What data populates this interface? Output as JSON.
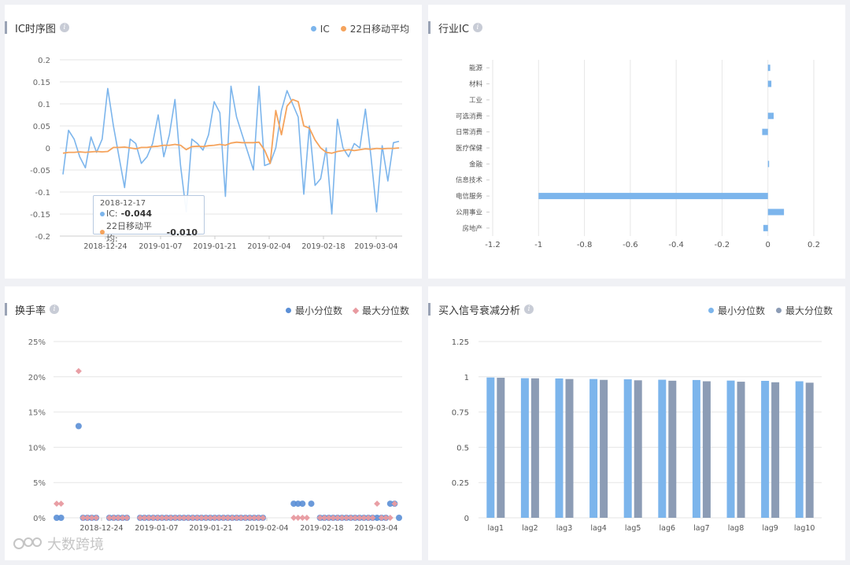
{
  "colors": {
    "ic": "#7cb5ec",
    "ma": "#f5a35c",
    "min": "#5b8fd6",
    "max": "#e89aa0",
    "bar_min": "#7cb5ec",
    "bar_max": "#8c9cb5",
    "grid": "#e6e6e6"
  },
  "panels": {
    "ic": {
      "title": "IC时序图",
      "info": "i",
      "legend": [
        "IC",
        "22日移动平均"
      ]
    },
    "industry": {
      "title": "行业IC",
      "info": "i"
    },
    "turnover": {
      "title": "换手率",
      "info": "i",
      "legend": [
        "最小分位数",
        "最大分位数"
      ]
    },
    "decay": {
      "title": "买入信号衰减分析",
      "info": "i",
      "legend": [
        "最小分位数",
        "最大分位数"
      ]
    }
  },
  "tooltip": {
    "date": "2018-12-17",
    "ic_label": "IC:",
    "ic_value": "-0.044",
    "ma_label": "22日移动平均:",
    "ma_value": "-0.010"
  },
  "watermark": "大数跨境",
  "chart_data": [
    {
      "type": "line",
      "ylim": [
        -0.2,
        0.2
      ],
      "yticks": [
        "0.2",
        "0.15",
        "0.1",
        "0.05",
        "0",
        "-0.05",
        "-0.1",
        "-0.15",
        "-0.2"
      ],
      "xticks": [
        "2018-12-24",
        "2019-01-07",
        "2019-01-21",
        "2019-02-04",
        "2019-02-18",
        "2019-03-04"
      ],
      "series": [
        {
          "name": "IC",
          "values": [
            -0.06,
            0.04,
            0.02,
            -0.02,
            -0.045,
            0.025,
            -0.01,
            0.02,
            0.135,
            0.05,
            -0.02,
            -0.09,
            0.02,
            0.01,
            -0.035,
            -0.02,
            0.01,
            0.075,
            -0.02,
            0.03,
            0.11,
            -0.04,
            -0.145,
            0.02,
            0.01,
            -0.005,
            0.03,
            0.105,
            0.08,
            -0.11,
            0.14,
            0.07,
            0.03,
            -0.01,
            -0.05,
            0.14,
            -0.04,
            -0.035,
            0.0,
            0.085,
            0.13,
            0.1,
            0.07,
            -0.105,
            0.05,
            -0.085,
            -0.07,
            0.0,
            -0.15,
            0.065,
            0.0,
            -0.02,
            0.01,
            0.0,
            0.088,
            -0.02,
            -0.145,
            0.005,
            -0.075,
            0.012,
            0.015
          ]
        },
        {
          "name": "22日移动平均",
          "values": [
            -0.012,
            -0.01,
            -0.01,
            -0.009,
            -0.01,
            -0.009,
            -0.008,
            -0.009,
            -0.008,
            0.001,
            0.001,
            0.002,
            0.0,
            -0.002,
            0.001,
            0.001,
            0.003,
            0.004,
            0.006,
            0.006,
            0.008,
            0.006,
            -0.004,
            0.003,
            0.004,
            0.003,
            0.005,
            0.006,
            0.008,
            0.006,
            0.011,
            0.013,
            0.012,
            0.012,
            0.012,
            0.013,
            -0.005,
            -0.035,
            0.085,
            0.03,
            0.095,
            0.11,
            0.105,
            0.05,
            0.045,
            0.018,
            0.0,
            -0.01,
            -0.012,
            -0.008,
            -0.006,
            -0.004,
            -0.006,
            -0.004,
            -0.002,
            -0.003,
            -0.001,
            -0.002,
            -0.001,
            -0.001,
            0.0
          ]
        }
      ]
    },
    {
      "type": "bar",
      "orientation": "horizontal",
      "categories": [
        "能源",
        "材料",
        "工业",
        "可选消费",
        "日常消费",
        "医疗保健",
        "金融",
        "信息技术",
        "电信服务",
        "公用事业",
        "房地产"
      ],
      "values": [
        0.01,
        0.015,
        0.0,
        0.025,
        -0.025,
        0.0,
        0.005,
        0.0,
        -1.0,
        0.07,
        -0.02
      ],
      "xlim": [
        -1.2,
        0.2
      ],
      "xticks": [
        "-1.2",
        "-1",
        "-0.8",
        "-0.6",
        "-0.4",
        "-0.2",
        "0",
        "0.2"
      ]
    },
    {
      "type": "scatter",
      "ylim": [
        0,
        25
      ],
      "yticks": [
        "25%",
        "20%",
        "15%",
        "10%",
        "5%",
        "0%"
      ],
      "xticks": [
        "2018-12-24",
        "2019-01-07",
        "2019-01-21",
        "2019-02-04",
        "2019-02-18",
        "2019-03-04"
      ],
      "series": [
        {
          "name": "最小分位数",
          "points": [
            [
              0,
              0
            ],
            [
              1,
              0
            ],
            [
              5,
              13.0
            ],
            [
              6,
              0
            ],
            [
              7,
              0
            ],
            [
              8,
              0
            ],
            [
              9,
              0
            ],
            [
              12,
              0
            ],
            [
              13,
              0
            ],
            [
              14,
              0
            ],
            [
              15,
              0
            ],
            [
              16,
              0
            ],
            [
              19,
              0
            ],
            [
              20,
              0
            ],
            [
              21,
              0
            ],
            [
              22,
              0
            ],
            [
              23,
              0
            ],
            [
              24,
              0
            ],
            [
              25,
              0
            ],
            [
              26,
              0
            ],
            [
              27,
              0
            ],
            [
              28,
              0
            ],
            [
              29,
              0
            ],
            [
              30,
              0
            ],
            [
              31,
              0
            ],
            [
              32,
              0
            ],
            [
              33,
              0
            ],
            [
              34,
              0
            ],
            [
              35,
              0
            ],
            [
              36,
              0
            ],
            [
              37,
              0
            ],
            [
              38,
              0
            ],
            [
              39,
              0
            ],
            [
              40,
              0
            ],
            [
              41,
              0
            ],
            [
              42,
              0
            ],
            [
              43,
              0
            ],
            [
              44,
              0
            ],
            [
              45,
              0
            ],
            [
              46,
              0
            ],
            [
              47,
              0
            ],
            [
              54,
              2.0
            ],
            [
              55,
              2.0
            ],
            [
              56,
              2.0
            ],
            [
              58,
              2.0
            ],
            [
              60,
              0
            ],
            [
              61,
              0
            ],
            [
              62,
              0
            ],
            [
              63,
              0
            ],
            [
              64,
              0
            ],
            [
              65,
              0
            ],
            [
              66,
              0
            ],
            [
              67,
              0
            ],
            [
              68,
              0
            ],
            [
              69,
              0
            ],
            [
              70,
              0
            ],
            [
              71,
              0
            ],
            [
              72,
              0
            ],
            [
              73,
              0
            ],
            [
              74,
              0
            ],
            [
              75,
              0
            ],
            [
              76,
              2.0
            ],
            [
              77,
              2.0
            ],
            [
              78,
              0
            ]
          ]
        },
        {
          "name": "最大分位数",
          "points": [
            [
              0,
              2.0
            ],
            [
              1,
              2.0
            ],
            [
              5,
              20.8
            ],
            [
              6,
              0
            ],
            [
              7,
              0
            ],
            [
              8,
              0
            ],
            [
              9,
              0
            ],
            [
              12,
              0
            ],
            [
              13,
              0
            ],
            [
              14,
              0
            ],
            [
              15,
              0
            ],
            [
              16,
              0
            ],
            [
              19,
              0
            ],
            [
              20,
              0
            ],
            [
              21,
              0
            ],
            [
              22,
              0
            ],
            [
              23,
              0
            ],
            [
              24,
              0
            ],
            [
              25,
              0
            ],
            [
              26,
              0
            ],
            [
              27,
              0
            ],
            [
              28,
              0
            ],
            [
              29,
              0
            ],
            [
              30,
              0
            ],
            [
              31,
              0
            ],
            [
              32,
              0
            ],
            [
              33,
              0
            ],
            [
              34,
              0
            ],
            [
              35,
              0
            ],
            [
              36,
              0
            ],
            [
              37,
              0
            ],
            [
              38,
              0
            ],
            [
              39,
              0
            ],
            [
              40,
              0
            ],
            [
              41,
              0
            ],
            [
              42,
              0
            ],
            [
              43,
              0
            ],
            [
              44,
              0
            ],
            [
              45,
              0
            ],
            [
              46,
              0
            ],
            [
              47,
              0
            ],
            [
              54,
              0
            ],
            [
              55,
              0
            ],
            [
              56,
              0
            ],
            [
              57,
              0
            ],
            [
              60,
              0
            ],
            [
              61,
              0
            ],
            [
              62,
              0
            ],
            [
              63,
              0
            ],
            [
              64,
              0
            ],
            [
              65,
              0
            ],
            [
              66,
              0
            ],
            [
              67,
              0
            ],
            [
              68,
              0
            ],
            [
              69,
              0
            ],
            [
              70,
              0
            ],
            [
              71,
              0
            ],
            [
              72,
              0
            ],
            [
              73,
              2.0
            ],
            [
              74,
              0
            ],
            [
              75,
              0
            ],
            [
              76,
              0
            ],
            [
              77,
              2.0
            ]
          ]
        }
      ]
    },
    {
      "type": "bar",
      "categories": [
        "lag1",
        "lag2",
        "lag3",
        "lag4",
        "lag5",
        "lag6",
        "lag7",
        "lag8",
        "lag9",
        "lag10"
      ],
      "ylim": [
        0,
        1.25
      ],
      "yticks": [
        "1.25",
        "1",
        "0.75",
        "0.5",
        "0.25",
        "0"
      ],
      "series": [
        {
          "name": "最小分位数",
          "values": [
            0.995,
            0.99,
            0.988,
            0.984,
            0.982,
            0.979,
            0.977,
            0.973,
            0.971,
            0.968
          ]
        },
        {
          "name": "最大分位数",
          "values": [
            0.993,
            0.989,
            0.984,
            0.978,
            0.975,
            0.972,
            0.968,
            0.965,
            0.961,
            0.958
          ]
        }
      ]
    }
  ]
}
